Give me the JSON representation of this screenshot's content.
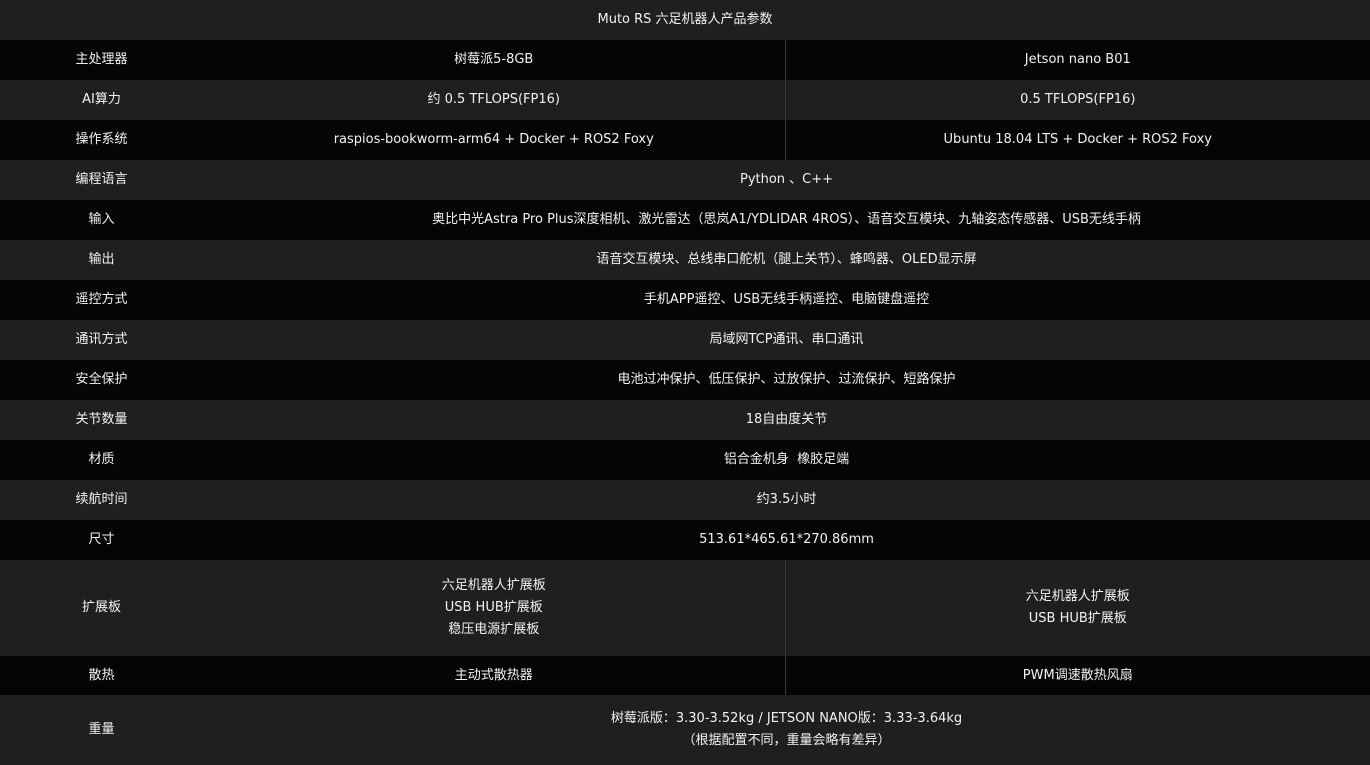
{
  "title": "Muto RS 六足机器人产品参数",
  "rows": [
    {
      "label": "主处理器",
      "a": "树莓派5-8GB",
      "b": "Jetson nano B01"
    },
    {
      "label": "AI算力",
      "a": "约 0.5 TFLOPS(FP16)",
      "b": "0.5 TFLOPS(FP16)"
    },
    {
      "label": "操作系统",
      "a": "raspios-bookworm-arm64 + Docker + ROS2 Foxy",
      "b": "Ubuntu 18.04 LTS + Docker + ROS2 Foxy"
    },
    {
      "label": "编程语言",
      "value": "Python 、C++"
    },
    {
      "label": "输入",
      "value": "奥比中光Astra Pro Plus深度相机、激光雷达（思岚A1/YDLIDAR 4ROS）、语音交互模块、九轴姿态传感器、USB无线手柄"
    },
    {
      "label": "输出",
      "value": "语音交互模块、总线串口舵机（腿上关节）、蜂鸣器、OLED显示屏"
    },
    {
      "label": "遥控方式",
      "value": "手机APP遥控、USB无线手柄遥控、电脑键盘遥控"
    },
    {
      "label": "通讯方式",
      "value": "局域网TCP通讯、串口通讯"
    },
    {
      "label": "安全保护",
      "value": "电池过冲保护、低压保护、过放保护、过流保护、短路保护"
    },
    {
      "label": "关节数量",
      "value": "18自由度关节"
    },
    {
      "label": "材质",
      "value": "铝合金机身  橡胶足端"
    },
    {
      "label": "续航时间",
      "value": "约3.5小时"
    },
    {
      "label": "尺寸",
      "value": "513.61*465.61*270.86mm"
    },
    {
      "label": "扩展板",
      "a_lines": [
        "六足机器人扩展板",
        "USB HUB扩展板",
        "稳压电源扩展板"
      ],
      "b_lines": [
        "六足机器人扩展板",
        "USB HUB扩展板"
      ]
    },
    {
      "label": "散热",
      "a": "主动式散热器",
      "b": "PWM调速散热风扇"
    },
    {
      "label": "重量",
      "lines": [
        "树莓派版：3.30-3.52kg / JETSON NANO版：3.33-3.64kg",
        "（根据配置不同，重量会略有差异）"
      ]
    }
  ]
}
